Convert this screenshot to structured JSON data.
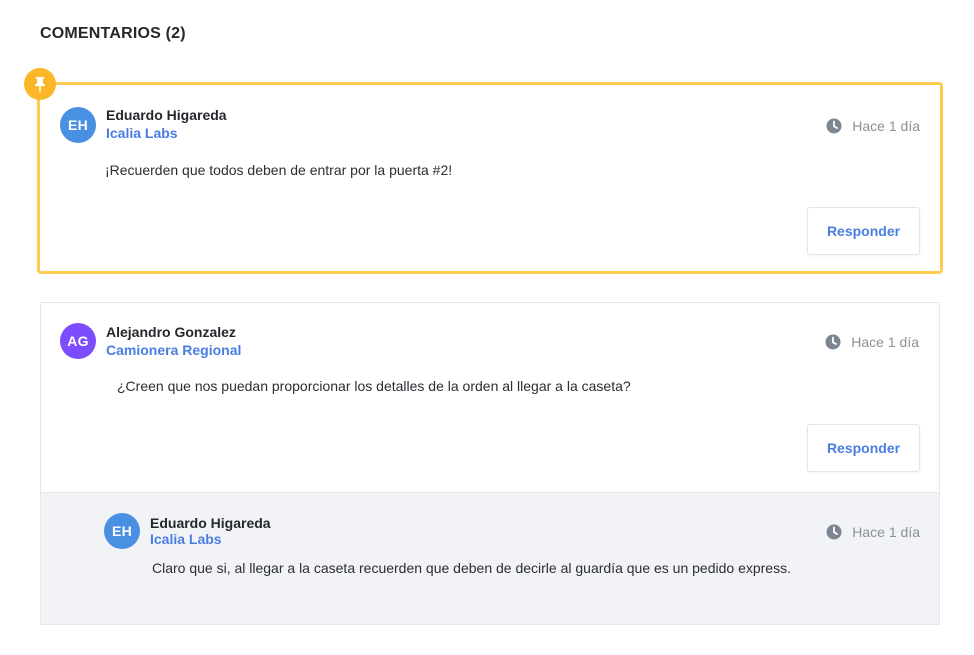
{
  "section": {
    "title": "COMENTARIOS (2)"
  },
  "comments": [
    {
      "pinned": true,
      "initials": "EH",
      "avatar_color": "#4a90e2",
      "author": "Eduardo Higareda",
      "company": "Icalia Labs",
      "time": "Hace 1 día",
      "text": "¡Recuerden que todos deben de entrar por la puerta #2!",
      "reply_label": "Responder"
    },
    {
      "pinned": false,
      "initials": "AG",
      "avatar_color": "#7c4dff",
      "author": "Alejandro Gonzalez",
      "company": "Camionera Regional",
      "time": "Hace 1 día",
      "text": "¿Creen que nos puedan proporcionar los detalles de la orden al llegar a la caseta?",
      "reply_label": "Responder",
      "replies": [
        {
          "initials": "EH",
          "avatar_color": "#4a90e2",
          "author": "Eduardo Higareda",
          "company": "Icalia Labs",
          "time": "Hace 1 día",
          "text": "Claro que si, al llegar a la caseta recuerden que deben de decirle al guardía que es un pedido express."
        }
      ]
    }
  ],
  "colors": {
    "pin_border": "#fdcb4f",
    "pin_badge": "#fbb62a",
    "link": "#4a7de2",
    "reply_bg": "#f2f3f6"
  },
  "icons": {
    "pin": "pin-icon",
    "clock": "clock-icon"
  }
}
